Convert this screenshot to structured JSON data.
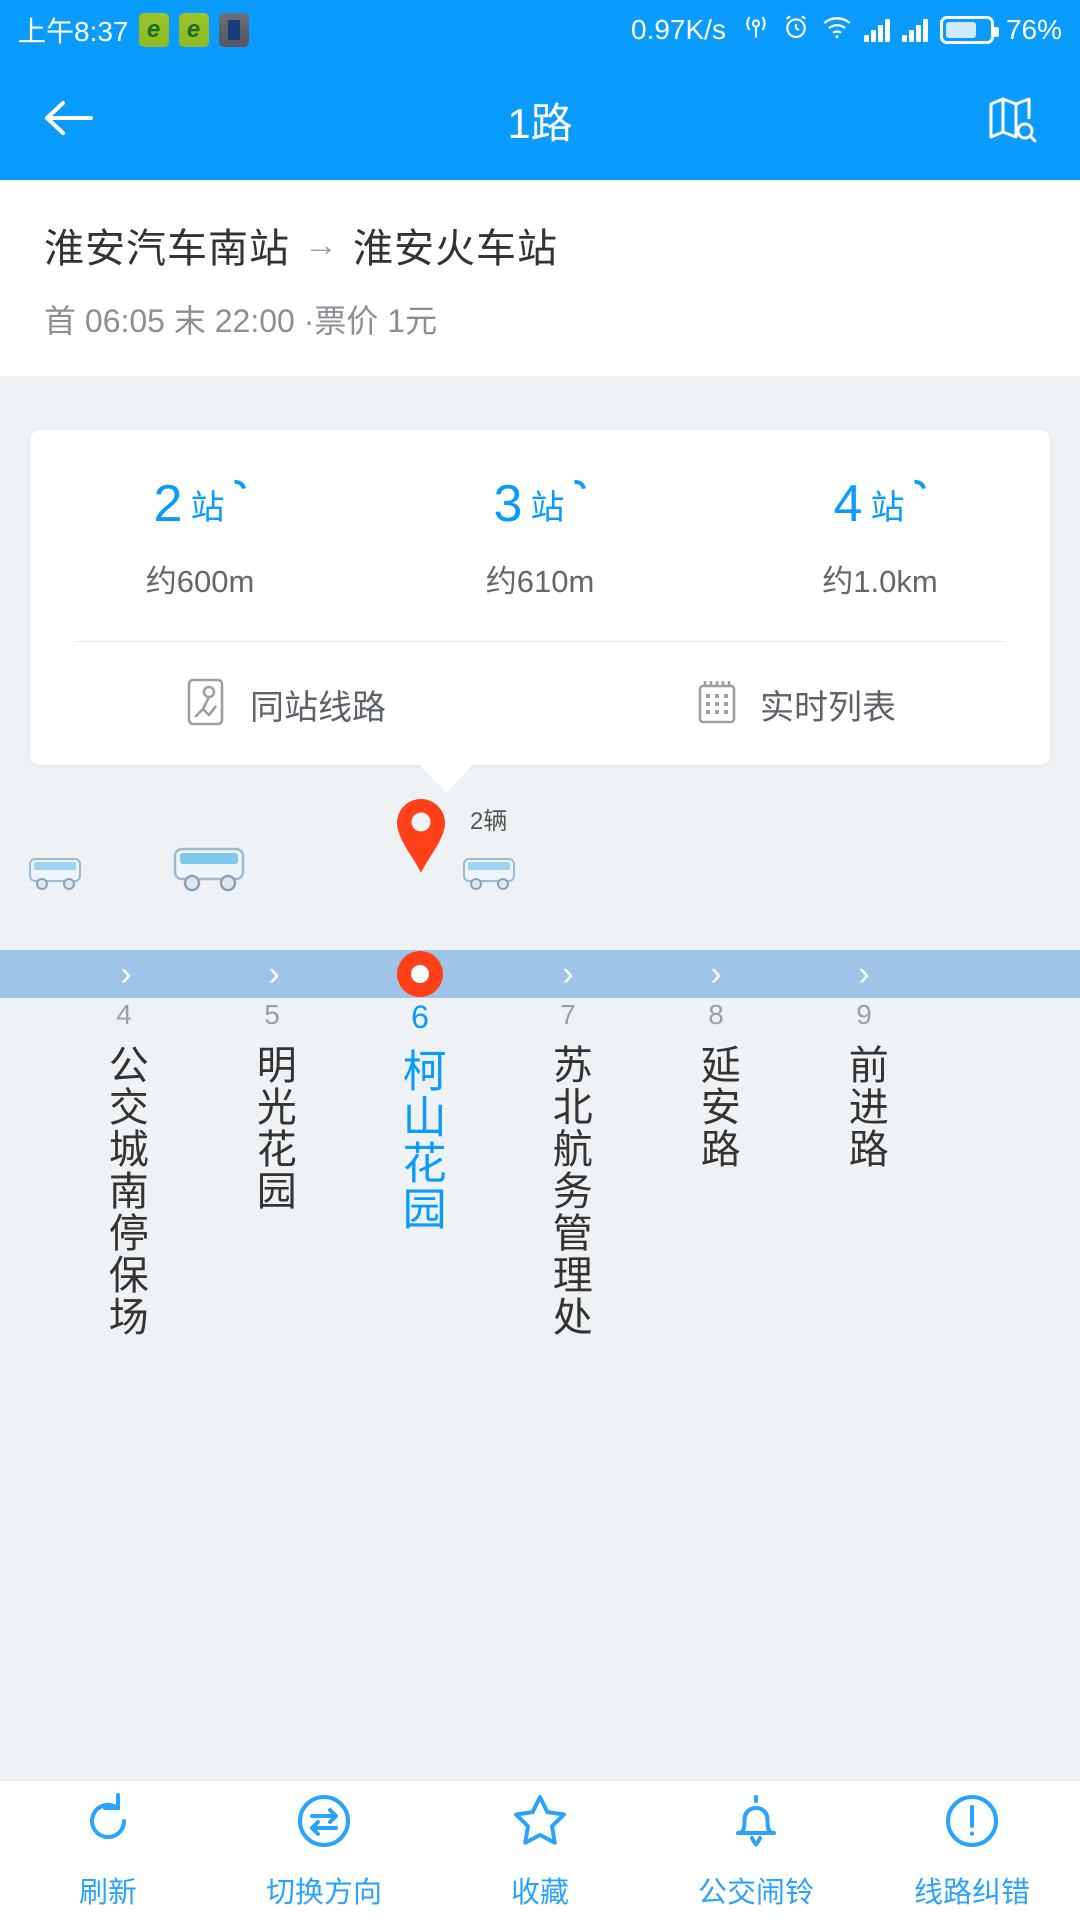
{
  "statusbar": {
    "time": "上午8:37",
    "network_speed": "0.97K/s",
    "battery_percent": "76%",
    "icons": [
      "app-green-icon",
      "app-green-icon",
      "app-dark-icon",
      "location-icon",
      "alarm-icon",
      "wifi-icon",
      "signal-icon",
      "signal-icon",
      "battery-icon"
    ]
  },
  "appbar": {
    "title": "1路",
    "back_icon": "back-arrow-icon",
    "map_icon": "map-search-icon"
  },
  "route": {
    "origin": "淮安汽车南站",
    "arrow": "→",
    "destination": "淮安火车站",
    "schedule": "首 06:05 末 22:00 ·票价 1元"
  },
  "arrivals": [
    {
      "stops": "2",
      "unit": "站",
      "distance": "约600m"
    },
    {
      "stops": "3",
      "unit": "站",
      "distance": "约610m"
    },
    {
      "stops": "4",
      "unit": "站",
      "distance": "约1.0km"
    }
  ],
  "card_actions": [
    {
      "label": "同站线路",
      "icon": "map-pin-route-icon"
    },
    {
      "label": "实时列表",
      "icon": "calendar-grid-icon"
    }
  ],
  "strip": {
    "bus_count_label": "2辆",
    "marker_icon": "red-map-pin-icon",
    "bus_icon": "bus-icon"
  },
  "stations": [
    {
      "num": "4",
      "name": "公交城南停保场",
      "active": false
    },
    {
      "num": "5",
      "name": "明光花园",
      "active": false
    },
    {
      "num": "6",
      "name": "柯山花园",
      "active": true
    },
    {
      "num": "7",
      "name": "苏北航务管理处",
      "active": false
    },
    {
      "num": "8",
      "name": "延安路",
      "active": false
    },
    {
      "num": "9",
      "name": "前进路",
      "active": false
    }
  ],
  "bottombar": [
    {
      "label": "刷新",
      "icon": "refresh-icon"
    },
    {
      "label": "切换方向",
      "icon": "swap-direction-icon"
    },
    {
      "label": "收藏",
      "icon": "star-icon"
    },
    {
      "label": "公交闹铃",
      "icon": "bell-icon"
    },
    {
      "label": "线路纠错",
      "icon": "exclamation-circle-icon"
    }
  ],
  "colors": {
    "brand_blue": "#0a9bff",
    "marker_red": "#ff4019",
    "track_blue": "#9ec4e8",
    "page_bg": "#eef2f5"
  }
}
